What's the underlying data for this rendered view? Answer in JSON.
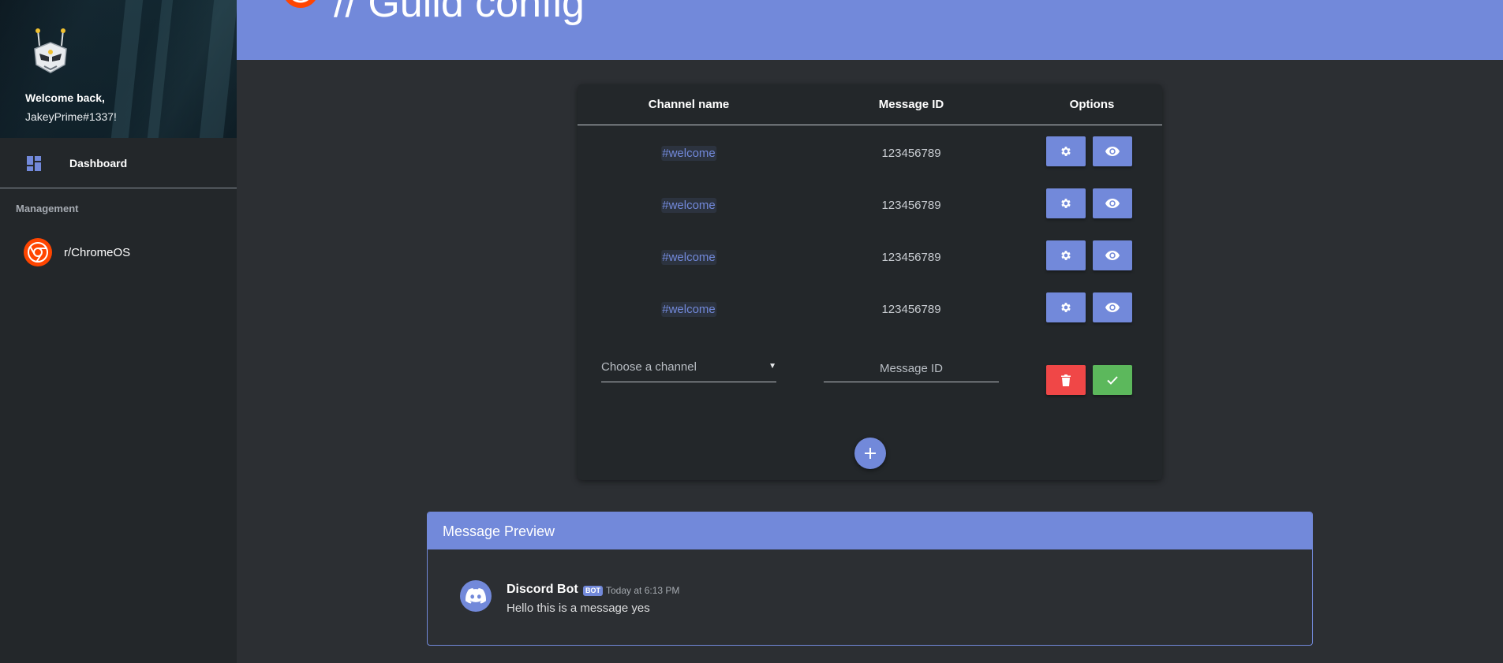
{
  "sidebar": {
    "welcome_line1": "Welcome back,",
    "welcome_line2": "JakeyPrime#1337!",
    "nav": {
      "dashboard_label": "Dashboard",
      "dashboard_icon": "dashboard-icon"
    },
    "section_label": "Management",
    "guilds": [
      {
        "name": "r/ChromeOS",
        "icon": "chrome-icon"
      }
    ]
  },
  "header": {
    "title": "// Guild config",
    "icon": "chrome-icon",
    "background_color": "#7289da"
  },
  "table": {
    "columns": [
      "Channel name",
      "Message ID",
      "Options"
    ],
    "rows": [
      {
        "channel": "#welcome",
        "message_id": "123456789"
      },
      {
        "channel": "#welcome",
        "message_id": "123456789"
      },
      {
        "channel": "#welcome",
        "message_id": "123456789"
      },
      {
        "channel": "#welcome",
        "message_id": "123456789"
      }
    ],
    "row_option_icons": [
      "gear-icon",
      "eye-icon"
    ],
    "new_row": {
      "channel_select_value": "Choose a channel",
      "message_id_placeholder": "Message ID",
      "message_id_value": "",
      "action_icons": [
        "trash-icon",
        "check-icon"
      ]
    },
    "add_button_icon": "plus-icon"
  },
  "preview": {
    "title": "Message Preview",
    "author": "Discord Bot",
    "tag": "BOT",
    "timestamp": "Today at 6:13 PM",
    "content": "Hello this is a message yes",
    "avatar_icon": "discord-logo-icon"
  },
  "colors": {
    "accent": "#7289da",
    "danger": "#f04747",
    "success": "#5cb85c",
    "background": "#2c2f33",
    "surface": "#23272a"
  }
}
